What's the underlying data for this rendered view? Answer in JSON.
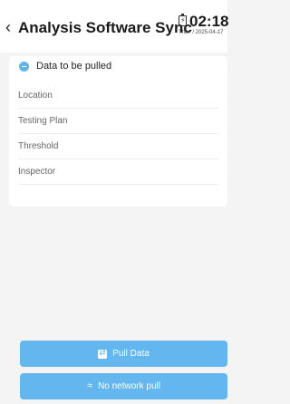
{
  "header": {
    "back_icon": "chevron-left-icon",
    "title": "Analysis Software Sync",
    "time": "02:18",
    "date": "Thur. / 2025-04-17",
    "battery_icon": "battery-charging-icon"
  },
  "card": {
    "icon": "info-dot-icon",
    "title": "Data to be pulled",
    "rows": [
      {
        "label": "Location"
      },
      {
        "label": "Testing Plan"
      },
      {
        "label": "Threshold"
      },
      {
        "label": "Inspector"
      }
    ]
  },
  "buttons": {
    "pull_label": "Pull Data",
    "pull_icon": "sync-icon",
    "offline_label": "No network pull",
    "offline_icon": "wifi-icon"
  },
  "colors": {
    "accent": "#63b6ee",
    "background": "#f4f4f4"
  }
}
